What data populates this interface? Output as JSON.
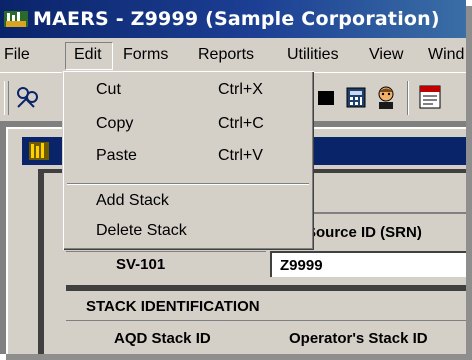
{
  "window": {
    "title": "MAERS - Z9999 (Sample Corporation)"
  },
  "menubar": {
    "items": [
      "File",
      "Edit",
      "Forms",
      "Reports",
      "Utilities",
      "View",
      "Wind"
    ]
  },
  "edit_menu": {
    "items": [
      {
        "label": "Cut",
        "shortcut": "Ctrl+X"
      },
      {
        "label": "Copy",
        "shortcut": "Ctrl+C"
      },
      {
        "label": "Paste",
        "shortcut": "Ctrl+V"
      },
      {
        "label": "Add Stack"
      },
      {
        "label": "Delete Stack"
      }
    ]
  },
  "toolbar": {
    "icons": [
      "people-icon",
      "chip-icon",
      "calculator-icon",
      "person-icon",
      "ent-form-icon"
    ]
  },
  "form": {
    "source_id_header": "Source ID (SRN)",
    "stack_value": "SV-101",
    "srn_value": "Z9999",
    "section_title": "STACK IDENTIFICATION",
    "col_aqd": "AQD Stack ID",
    "col_operator": "Operator's Stack ID"
  },
  "colors": {
    "titlebar": "#0a246a",
    "face": "#d4d0c8",
    "mdi": "#808080"
  }
}
